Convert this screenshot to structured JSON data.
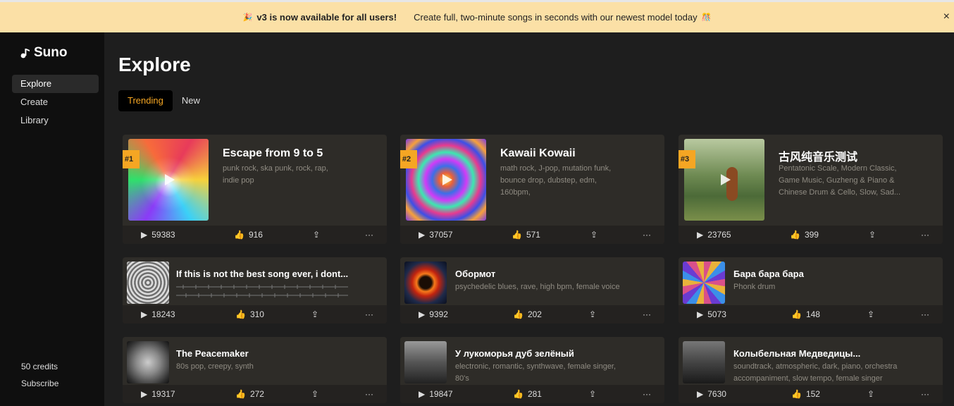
{
  "banner": {
    "emoji_left": "🎉",
    "headline": "v3 is now available for all users!",
    "message": "Create full, two-minute songs in seconds with our newest model today",
    "emoji_right": "🎊",
    "close": "×"
  },
  "sidebar": {
    "logo": "Suno",
    "items": [
      {
        "label": "Explore"
      },
      {
        "label": "Create"
      },
      {
        "label": "Library"
      }
    ],
    "credits": "50 credits",
    "subscribe": "Subscribe"
  },
  "page": {
    "title": "Explore",
    "tabs": [
      {
        "label": "Trending"
      },
      {
        "label": "New"
      }
    ]
  },
  "featured": [
    {
      "rank": "#1",
      "title": "Escape from 9 to 5",
      "tags": "punk rock, ska punk, rock, rap, indie pop",
      "plays": "59383",
      "likes": "916"
    },
    {
      "rank": "#2",
      "title": "Kawaii Kowaii",
      "tags": "math rock, J-pop, mutation funk, bounce drop, dubstep, edm, 160bpm,",
      "plays": "37057",
      "likes": "571"
    },
    {
      "rank": "#3",
      "title": "古风纯音乐测试",
      "tags": "Pentatonic Scale, Modern Classic, Game Music, Guzheng & Piano & Chinese Drum & Cello, Slow, Sad...",
      "plays": "23765",
      "likes": "399"
    }
  ],
  "songs": [
    {
      "title": "If this is not the best song ever, i dont...",
      "tags": "",
      "plays": "18243",
      "likes": "310"
    },
    {
      "title": "Обормот",
      "tags": "psychedelic blues, rave, high bpm, female voice",
      "plays": "9392",
      "likes": "202"
    },
    {
      "title": "Бара бара бара",
      "tags": "Phonk drum",
      "plays": "5073",
      "likes": "148"
    },
    {
      "title": "The Peacemaker",
      "tags": "80s pop, creepy, synth",
      "plays": "19317",
      "likes": "272"
    },
    {
      "title": "У лукоморья дуб зелёный",
      "tags": "electronic, romantic, synthwave, female singer, 80's",
      "plays": "19847",
      "likes": "281"
    },
    {
      "title": "Колыбельная Медведицы...",
      "tags": "soundtrack, atmospheric, dark, piano, orchestra accompaniment, slow tempo, female singer",
      "plays": "7630",
      "likes": "152"
    }
  ],
  "icons": {
    "play": "play-icon",
    "like": "thumbs-up-icon",
    "share": "share-icon",
    "more": "more-icon"
  },
  "colors": {
    "accent": "#f5a623",
    "banner": "#fbe0a6"
  }
}
